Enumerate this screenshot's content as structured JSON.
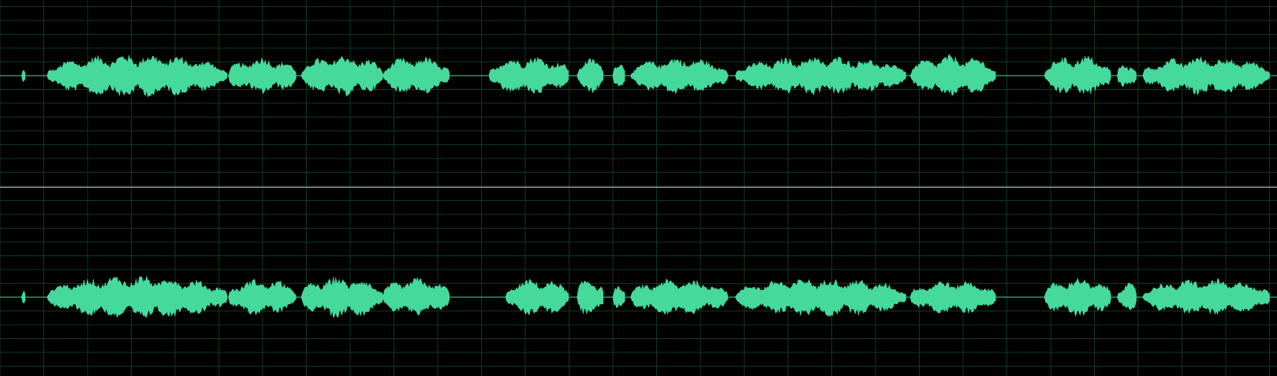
{
  "editor": {
    "view": "stereo-waveform",
    "colors": {
      "background": "#000000",
      "grid": "#0d3a1f",
      "waveform": "#45d99c",
      "baseline": "#45d99c",
      "divider": "#c8c8c8"
    },
    "channels": [
      {
        "id": "left",
        "segments": [
          {
            "start": 0.017,
            "end": 0.02,
            "level": 0.35
          },
          {
            "start": 0.037,
            "end": 0.178,
            "level": 0.95
          },
          {
            "start": 0.179,
            "end": 0.232,
            "level": 0.8
          },
          {
            "start": 0.236,
            "end": 0.3,
            "level": 0.9
          },
          {
            "start": 0.3,
            "end": 0.352,
            "level": 0.85
          },
          {
            "start": 0.383,
            "end": 0.446,
            "level": 0.85
          },
          {
            "start": 0.452,
            "end": 0.473,
            "level": 0.75
          },
          {
            "start": 0.48,
            "end": 0.49,
            "level": 0.55
          },
          {
            "start": 0.494,
            "end": 0.57,
            "level": 0.8
          },
          {
            "start": 0.576,
            "end": 0.71,
            "level": 0.85
          },
          {
            "start": 0.713,
            "end": 0.78,
            "level": 0.9
          },
          {
            "start": 0.818,
            "end": 0.87,
            "level": 0.9
          },
          {
            "start": 0.875,
            "end": 0.89,
            "level": 0.6
          },
          {
            "start": 0.895,
            "end": 0.995,
            "level": 0.85
          }
        ]
      },
      {
        "id": "right",
        "segments": [
          {
            "start": 0.017,
            "end": 0.02,
            "level": 0.35
          },
          {
            "start": 0.037,
            "end": 0.178,
            "level": 0.95
          },
          {
            "start": 0.179,
            "end": 0.232,
            "level": 0.8
          },
          {
            "start": 0.236,
            "end": 0.3,
            "level": 0.9
          },
          {
            "start": 0.3,
            "end": 0.352,
            "level": 0.85
          },
          {
            "start": 0.396,
            "end": 0.446,
            "level": 0.8
          },
          {
            "start": 0.452,
            "end": 0.473,
            "level": 0.85
          },
          {
            "start": 0.48,
            "end": 0.49,
            "level": 0.55
          },
          {
            "start": 0.494,
            "end": 0.57,
            "level": 0.8
          },
          {
            "start": 0.576,
            "end": 0.71,
            "level": 0.85
          },
          {
            "start": 0.713,
            "end": 0.78,
            "level": 0.75
          },
          {
            "start": 0.818,
            "end": 0.87,
            "level": 0.85
          },
          {
            "start": 0.875,
            "end": 0.89,
            "level": 0.65
          },
          {
            "start": 0.895,
            "end": 0.995,
            "level": 0.8
          }
        ]
      }
    ]
  }
}
